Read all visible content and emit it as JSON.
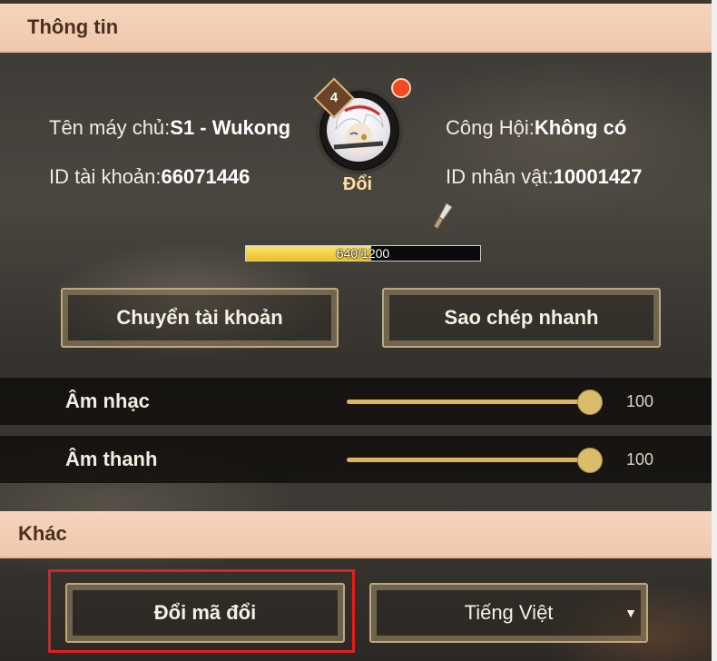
{
  "info_section": {
    "title": "Thông tin",
    "server_label": "Tên máy chủ:",
    "server_value": "S1 - Wukong",
    "account_id_label": "ID tài khoản:",
    "account_id_value": "66071446",
    "guild_label": "Công Hội:",
    "guild_value": "Không có",
    "character_id_label": "ID nhân vật:",
    "character_id_value": "10001427"
  },
  "avatar": {
    "level": "4",
    "change_label": "Đổi",
    "notification": true
  },
  "exp": {
    "text": "640/1200",
    "current": 640,
    "max": 1200
  },
  "buttons": {
    "switch_account": "Chuyển tài khoản",
    "quick_copy": "Sao chép nhanh"
  },
  "audio": {
    "music_label": "Âm nhạc",
    "music_value": "100",
    "music_level": 1.0,
    "sound_label": "Âm thanh",
    "sound_value": "100",
    "sound_level": 1.0
  },
  "other_section": {
    "title": "Khác",
    "redeem_button": "Đổi mã đổi",
    "language_value": "Tiếng Việt"
  },
  "colors": {
    "header_bg": "#f0c8ad",
    "accent_gold": "#d3b66c",
    "highlight_red": "#e0201d",
    "notification_red": "#f24a1f"
  }
}
